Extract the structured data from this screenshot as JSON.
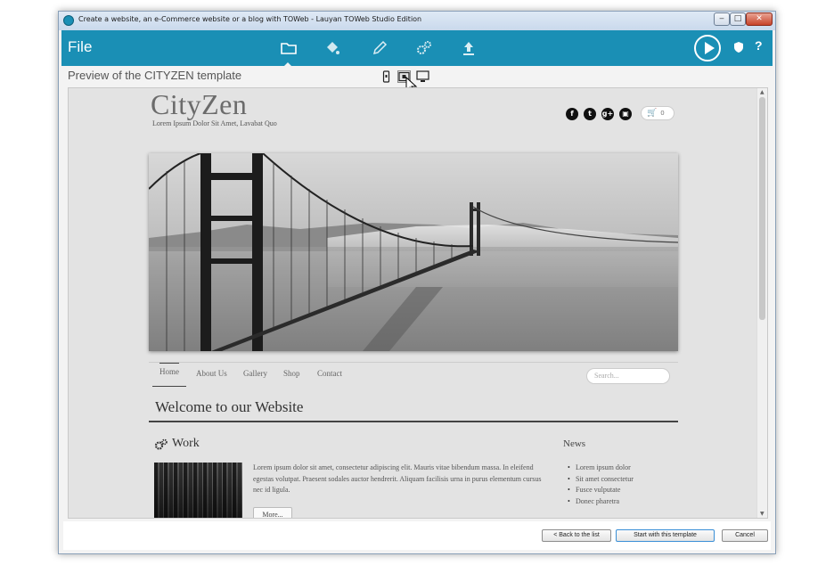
{
  "window": {
    "title": "Create a website, an e-Commerce website or a blog with TOWeb - Lauyan TOWeb Studio Edition",
    "minimize": "‒",
    "maximize": "□",
    "close": "✕"
  },
  "toolbar": {
    "file_label": "File",
    "help_label": "?",
    "icons": [
      "folder-icon",
      "paint-bucket-icon",
      "pencil-icon",
      "gears-icon",
      "upload-icon"
    ],
    "accent": "#1a8fb5"
  },
  "preview": {
    "title": "Preview of the CITYZEN template",
    "view_modes": [
      "phone-view-icon",
      "tablet-view-icon",
      "desktop-view-icon"
    ]
  },
  "site": {
    "logo": "CityZen",
    "tagline": "Lorem Ipsum Dolor Sit Amet, Lavabat Quo",
    "social": [
      "f",
      "t",
      "g+",
      "▣"
    ],
    "cart_count": "0",
    "nav": [
      "Home",
      "About Us",
      "Gallery",
      "Shop",
      "Contact"
    ],
    "search_placeholder": "Search...",
    "welcome": "Welcome to our Website",
    "work_title": "Work",
    "work_text": "Lorem ipsum dolor sit amet, consectetur adipiscing elit. Mauris vitae bibendum massa. In eleifend egestas volutpat. Praesent sodales auctor hendrerit. Aliquam facilisis urna in purus elementum cursus nec id ligula.",
    "more_label": "More...",
    "news_title": "News",
    "news_items": [
      "Lorem ipsum dolor",
      "Sit amet consectetur",
      "Fusce vulputate",
      "Donec pharetra"
    ]
  },
  "footer": {
    "back_label": "< Back to the list",
    "start_label": "Start with this template",
    "cancel_label": "Cancel"
  }
}
